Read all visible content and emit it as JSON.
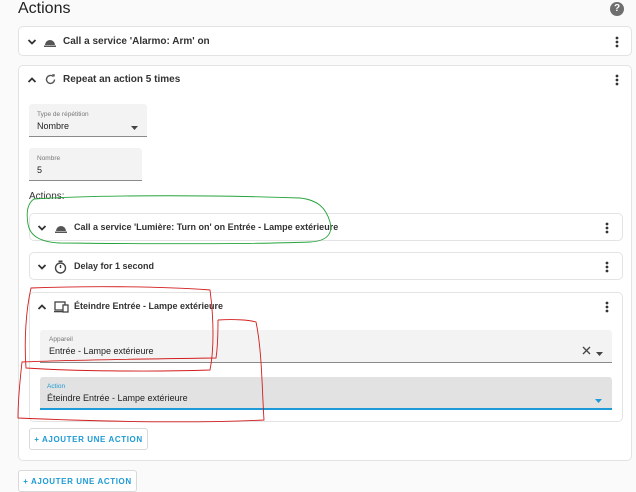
{
  "header": {
    "title": "Actions"
  },
  "actions": [
    {
      "label": "Call a service 'Alarmo: Arm' on"
    },
    {
      "label": "Repeat an action 5 times",
      "repeat_type": {
        "label": "Type de répétition",
        "value": "Nombre"
      },
      "count": {
        "label": "Nombre",
        "value": "5"
      },
      "sub_header": "Actions:",
      "sub_actions": [
        {
          "label": "Call a service 'Lumière: Turn on' on Entrée - Lampe extérieure"
        },
        {
          "label": "Delay for 1 second"
        },
        {
          "label": "Éteindre Entrée - Lampe extérieure",
          "device": {
            "label": "Appareil",
            "value": "Entrée - Lampe extérieure"
          },
          "action": {
            "label": "Action",
            "value": "Éteindre Entrée - Lampe extérieure"
          }
        }
      ],
      "add_label": "+ AJOUTER UNE ACTION"
    }
  ],
  "footer": {
    "add_label": "+ AJOUTER UNE ACTION"
  },
  "colors": {
    "accent": "#1e9ad6",
    "annotation_red": "#d21d1d",
    "annotation_green": "#23a33a"
  }
}
